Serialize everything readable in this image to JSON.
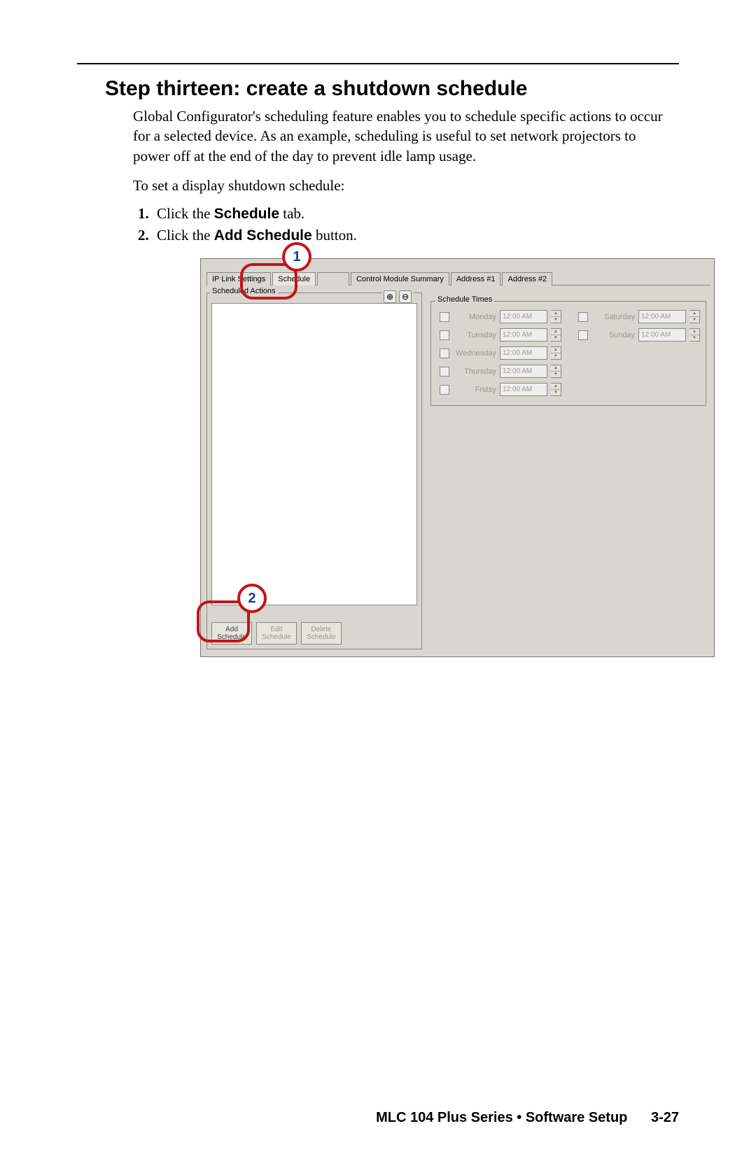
{
  "heading": "Step thirteen: create a shutdown schedule",
  "intro": "Global Configurator's scheduling feature enables you to schedule specific actions to occur for a selected device.  As an example, scheduling is useful to set network projectors to power off at the end of the day to prevent idle lamp usage.",
  "lead": "To set a display shutdown schedule:",
  "steps": [
    {
      "pre": "Click the",
      "bold": "Schedule",
      "post": "tab."
    },
    {
      "pre": "Click the",
      "bold": "Add Schedule",
      "post": "button."
    }
  ],
  "callouts": [
    "1",
    "2"
  ],
  "tabs": [
    "IP Link Settings",
    "Schedule",
    "Control Module Summary",
    "Address #1",
    "Address #2"
  ],
  "panel": {
    "sa_legend": "Scheduled Actions",
    "st_legend": "Schedule Times",
    "btn_add": "Add Schedule",
    "btn_edit": "Edit Schedule",
    "btn_delete": "Delete Schedule"
  },
  "days": [
    "Monday",
    "Tuesday",
    "Wednesday",
    "Thursday",
    "Friday",
    "Saturday",
    "Sunday"
  ],
  "time": "12:00 AM",
  "footer": {
    "title": "MLC 104 Plus Series • Software Setup",
    "page": "3-27"
  }
}
